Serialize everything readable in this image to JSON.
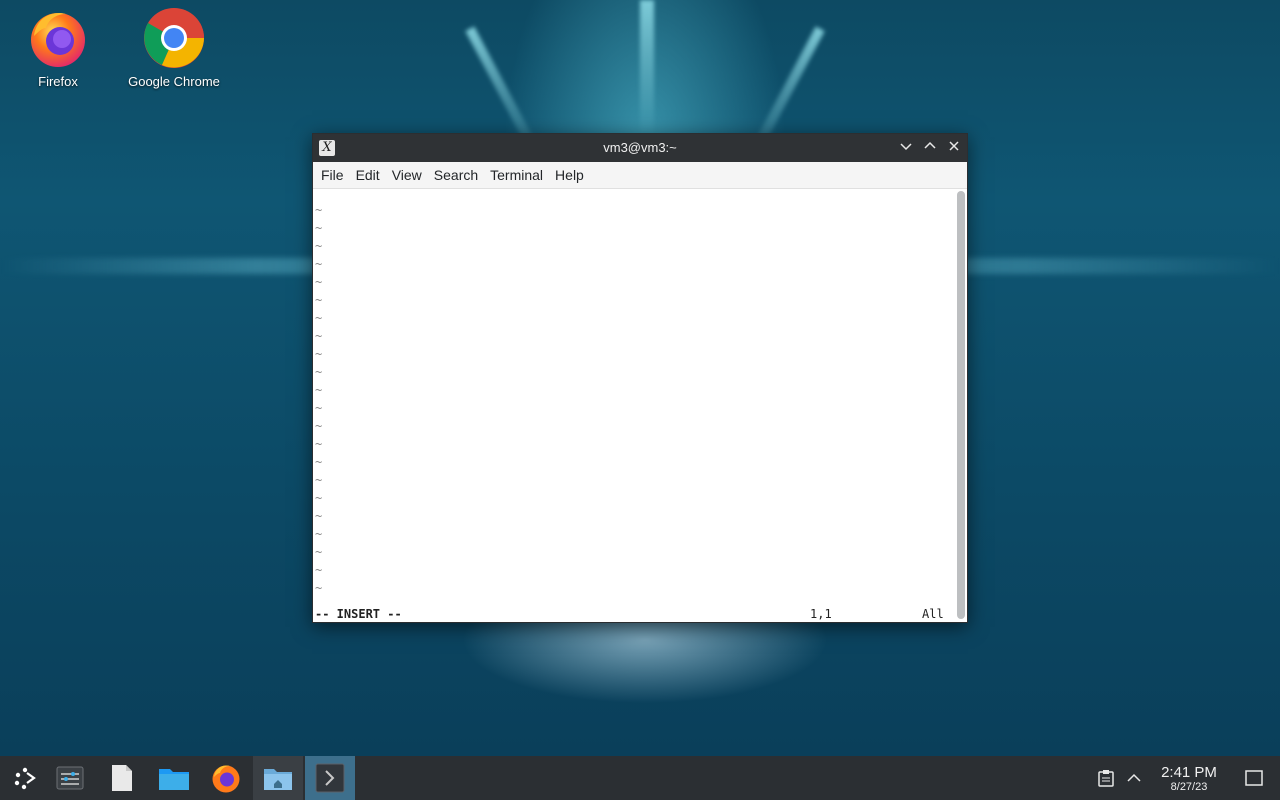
{
  "desktop": {
    "icons": [
      {
        "label": "Firefox",
        "icon": "firefox-icon"
      },
      {
        "label": "Google Chrome",
        "icon": "chrome-icon"
      }
    ]
  },
  "window": {
    "title": "vm3@vm3:~",
    "menu": [
      "File",
      "Edit",
      "View",
      "Search",
      "Terminal",
      "Help"
    ],
    "controls": [
      "minimize",
      "maximize",
      "close"
    ]
  },
  "vim": {
    "tilde_lines": 22,
    "mode": "-- INSERT --",
    "cursor_pos": "1,1",
    "scroll_pos": "All"
  },
  "taskbar": {
    "apps": [
      "application-launcher-icon",
      "system-settings-icon",
      "text-editor-icon",
      "file-manager-icon",
      "firefox-icon",
      "home-folder-icon",
      "terminal-icon"
    ],
    "tray": [
      "clipboard-icon",
      "tray-expand-icon"
    ],
    "time": "2:41 PM",
    "date": "8/27/23"
  },
  "colors": {
    "accent": "#3d6f8c",
    "titlebar": "#2f3235",
    "taskbar": "#2b2f33"
  }
}
